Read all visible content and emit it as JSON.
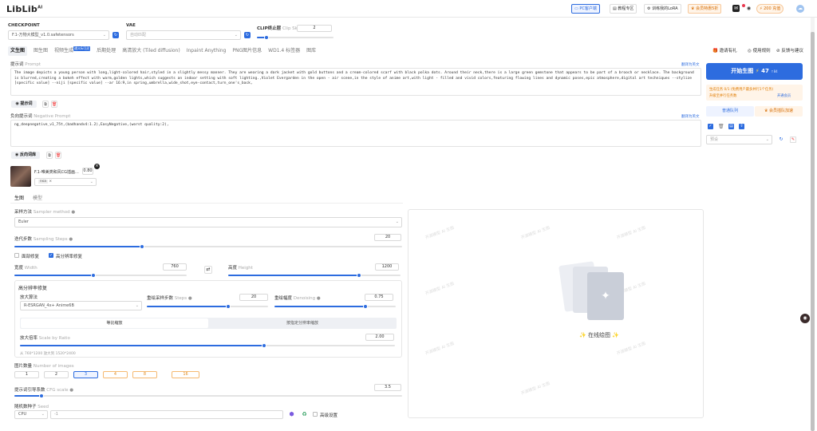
{
  "app": {
    "logo": "LibLib",
    "logo_sup": "AI"
  },
  "topbar": {
    "pc_client": "PC客户端",
    "tutorial": "教程专区",
    "train_lora": "训练我的LoRA",
    "vip": "会员特惠5折",
    "points": "200 充值"
  },
  "model_bar": {
    "checkpoint_label": "CHECKPOINT",
    "checkpoint_value": "F.1-万物大模型_v1.0.safetensors",
    "vae_label": "VAE",
    "vae_value": "自动匹配",
    "clip_label": "CLIP终止层",
    "clip_sub": "Clip Skip",
    "clip_value": "2"
  },
  "tabs": [
    {
      "label": "文生图",
      "active": true
    },
    {
      "label": "图生图"
    },
    {
      "label": "视频生成",
      "badge": "通义&可灵"
    },
    {
      "label": "后期处理"
    },
    {
      "label": "高清放大 (Tiled diffusion)"
    },
    {
      "label": "Inpaint Anything"
    },
    {
      "label": "PNG图片信息"
    },
    {
      "label": "WD1.4 标签器"
    },
    {
      "label": "图库"
    }
  ],
  "prompt": {
    "label": "提示词",
    "sub": "Prompt",
    "translate": "翻译为英文",
    "text": "The image depicts a young person with long,light-colored hair,styled in a slightly messy manner. They are wearing a dark jacket with gold buttons and a cream-colored scarf with black polka dots. Around their neck,there is a large green gemstone that appears to be part of a brooch or necklace. The background is blurred,creating a bokeh effect with warm,golden lights,which suggests an indoor setting with soft lighting.,Violet Evergarden in the open - air scene,in the style of anime art,with light - filled and vivid colors,featuring flowing lines and dynamic poses,epic atmosphere,digital art techniques --stylize [specific value] --niji [specific value] --ar 16:9,in spring,umbrella,wide_shot,eye-contact,turn_one's_back,",
    "lib_button": "提示词"
  },
  "negative": {
    "label": "负向提示词",
    "sub": "Negative Prompt",
    "translate": "翻译为英文",
    "text": "ng_deepnegative_v1_75t,(badhandv4:1.2),EasyNegative,(worst quality:2),",
    "lib_button": "反向词库"
  },
  "lora": {
    "name": "F.1-唯美类和风CG插画...",
    "weight": "0.80",
    "chip": "nsa"
  },
  "subtabs": [
    {
      "label": "生图",
      "active": true
    },
    {
      "label": "模型"
    }
  ],
  "sampler": {
    "label": "采样方法",
    "sub": "Sampler method",
    "value": "Euler"
  },
  "steps": {
    "label": "迭代步数",
    "sub": "Sampling Steps",
    "value": "20"
  },
  "toggles": {
    "face_fix": "面部修复",
    "hires_fix": "高分辨率修复"
  },
  "width": {
    "label": "宽度",
    "sub": "Width",
    "value": "760"
  },
  "height": {
    "label": "高度",
    "sub": "Height",
    "value": "1200"
  },
  "hires": {
    "title": "高分辨率修复",
    "upscaler_label": "放大算法",
    "upscaler_value": "R-ESRGAN_4x+ Anime6B",
    "steps_label": "重绘采样步数",
    "steps_sub": "Steps",
    "steps_value": "20",
    "denoise_label": "重绘幅度",
    "denoise_sub": "Denoising",
    "denoise_value": "0.75",
    "mode_a": "等比缩放",
    "mode_b": "按指定分辨率缩放",
    "scale_label": "放大倍率",
    "scale_sub": "Scale by Ratio",
    "scale_value": "2.00",
    "size_note": "从 760*1200 放大到 1520*2400"
  },
  "batch": {
    "label": "图片数量",
    "sub": "Number of images",
    "options": [
      "1",
      "2",
      "3",
      "4",
      "8",
      "16"
    ],
    "selected": "3"
  },
  "cfg": {
    "label": "提示词引导系数",
    "sub": "CFG scale",
    "value": "3.5"
  },
  "seed": {
    "label": "随机数种子",
    "sub": "Seed",
    "device": "CPU",
    "value": "-1",
    "advanced": "高级设置"
  },
  "right": {
    "limited": "邀请有礼",
    "rules": "使用规则",
    "feedback": "反馈与建议",
    "generate": "开始生图",
    "cost": "47",
    "queue_info": "生成任务 0/1 (免费用户最多并行1个任务)",
    "queue_upgrade": "升级至并行任务数",
    "upgrade_link": "开通会员",
    "queue_tab": "普通队列",
    "vip_queue": "会员插队加速",
    "preset": "预设"
  },
  "canvas": {
    "status": "在线绘图",
    "watermark": "开源模型 AI 生图"
  }
}
